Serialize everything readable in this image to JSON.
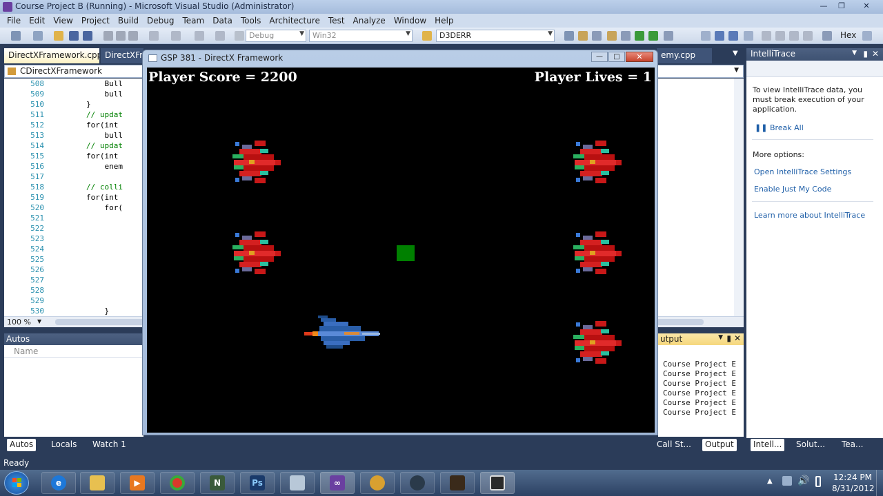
{
  "window": {
    "title": "Course Project B (Running) - Microsoft Visual Studio (Administrator)"
  },
  "menu": [
    "File",
    "Edit",
    "View",
    "Project",
    "Build",
    "Debug",
    "Team",
    "Data",
    "Tools",
    "Architecture",
    "Test",
    "Analyze",
    "Window",
    "Help"
  ],
  "toolbar": {
    "config": "Debug",
    "platform": "Win32",
    "find": "D3DERR",
    "hex_label": "Hex"
  },
  "doc_tabs": [
    {
      "label": "DirectXFramework.cpp",
      "active": true
    },
    {
      "label": "DirectXFran",
      "active": false
    },
    {
      "label": "emy.cpp",
      "active": false
    }
  ],
  "nav": {
    "scope": "CDirectXFramework"
  },
  "editor": {
    "zoom": "100 %",
    "lines": [
      {
        "n": "508",
        "code": "            Bull"
      },
      {
        "n": "509",
        "code": "            bull"
      },
      {
        "n": "510",
        "code": "        }"
      },
      {
        "n": "511",
        "code": "        // updat"
      },
      {
        "n": "512",
        "code": "        for(int "
      },
      {
        "n": "513",
        "code": "            bull"
      },
      {
        "n": "514",
        "code": "        // updat"
      },
      {
        "n": "515",
        "code": "        for(int "
      },
      {
        "n": "516",
        "code": "            enem"
      },
      {
        "n": "517",
        "code": ""
      },
      {
        "n": "518",
        "code": "        // colli"
      },
      {
        "n": "519",
        "code": "        for(int "
      },
      {
        "n": "520",
        "code": "            for("
      },
      {
        "n": "521",
        "code": ""
      },
      {
        "n": "522",
        "code": ""
      },
      {
        "n": "523",
        "code": ""
      },
      {
        "n": "524",
        "code": ""
      },
      {
        "n": "525",
        "code": ""
      },
      {
        "n": "526",
        "code": ""
      },
      {
        "n": "527",
        "code": ""
      },
      {
        "n": "528",
        "code": ""
      },
      {
        "n": "529",
        "code": ""
      },
      {
        "n": "530",
        "code": "            }"
      }
    ]
  },
  "autos": {
    "title": "Autos",
    "column": "Name"
  },
  "output": {
    "title": "utput",
    "lines": [
      "Course Project E",
      "Course Project E",
      "Course Project E",
      "Course Project E",
      "Course Project E",
      "Course Project E"
    ]
  },
  "intellitrace": {
    "title": "IntelliTrace",
    "message": "To view IntelliTrace data, you must break execution of your application.",
    "break_all": "Break All",
    "more_options": "More options:",
    "links": [
      "Open IntelliTrace Settings",
      "Enable Just My Code"
    ],
    "learn_more": "Learn more about IntelliTrace"
  },
  "bottom_tabs_left": [
    "Autos",
    "Locals",
    "Watch 1"
  ],
  "bottom_tabs_right": [
    "Call St...",
    "Output"
  ],
  "side_tabs": [
    "Intell...",
    "Solut...",
    "Tea..."
  ],
  "status": "Ready",
  "game": {
    "title": "GSP 381 - DirectX Framework",
    "score_text": "Player Score = 2200",
    "lives_text": "Player Lives = 1"
  },
  "taskbar": {
    "time": "12:24 PM",
    "date": "8/31/2012"
  },
  "colors": {
    "vs_chrome": "#2b3c59",
    "game_bg": "#000000",
    "pickup": "#008000",
    "link": "#1f5fa8"
  }
}
